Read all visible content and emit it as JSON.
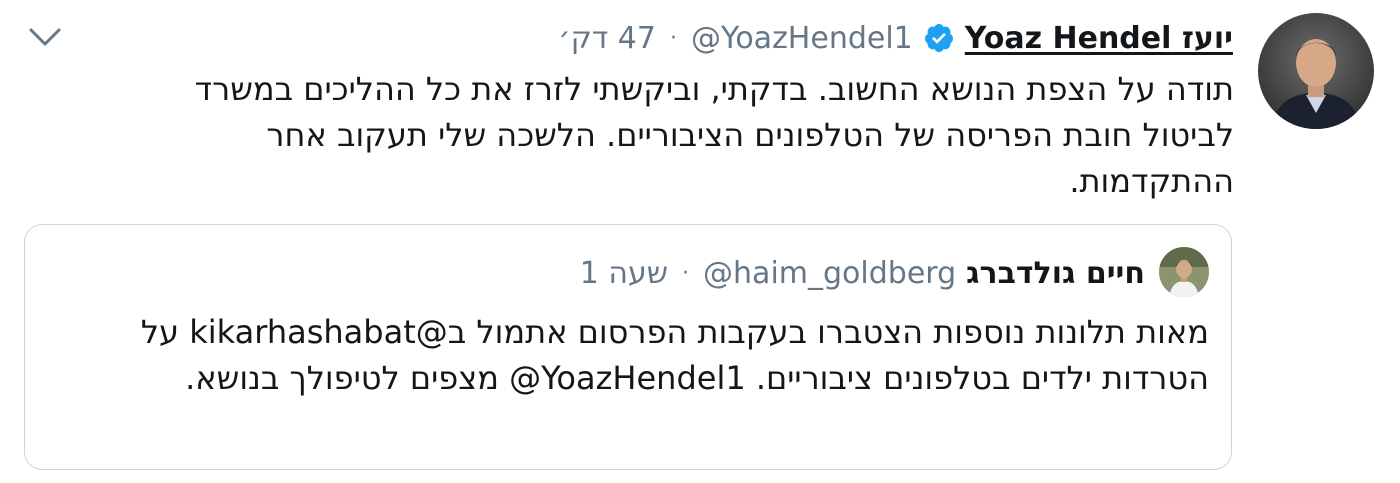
{
  "tweet": {
    "author": {
      "display_name": "יועז Yoaz Hendel",
      "handle": "@YoazHendel1",
      "verified": true,
      "avatar_icon": "profile-photo"
    },
    "time": "47 דק׳",
    "separator": "·",
    "text": "תודה על הצפת הנושא החשוב. בדקתי, וביקשתי לזרז את כל ההליכים במשרד לביטול חובת הפריסה של הטלפונים הציבוריים. הלשכה שלי תעקוב אחר ההתקדמות.",
    "more_icon": "chevron-down-icon"
  },
  "quoted_tweet": {
    "author": {
      "display_name": "חיים גולדברג",
      "handle": "@haim_goldberg",
      "avatar_icon": "profile-photo"
    },
    "time": "שעה 1",
    "separator": "·",
    "text": "מאות תלונות נוספות הצטברו בעקבות הפרסום אתמול ב@kikarhashabat על הטרדות ילדים בטלפונים ציבוריים. YoazHendel1@ מצפים לטיפולך בנושא."
  },
  "colors": {
    "text": "#14171a",
    "secondary": "#657786",
    "verified": "#1da1f2",
    "border": "#ccd6dd"
  }
}
